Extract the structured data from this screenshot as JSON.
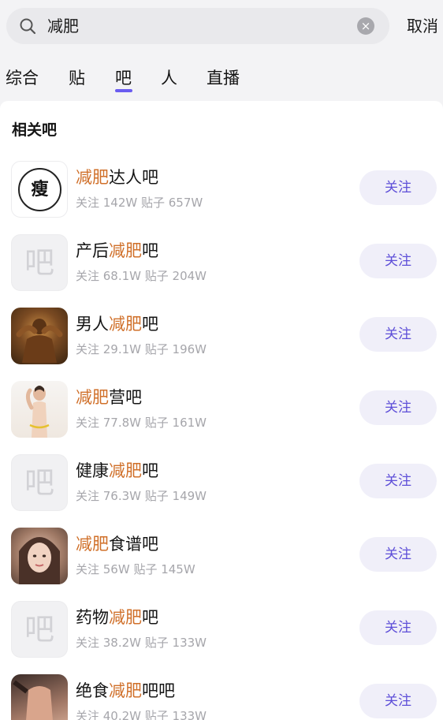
{
  "search": {
    "query": "减肥",
    "cancel_label": "取消"
  },
  "tabs": [
    {
      "label": "综合"
    },
    {
      "label": "贴"
    },
    {
      "label": "吧",
      "active": true
    },
    {
      "label": "人"
    },
    {
      "label": "直播"
    }
  ],
  "section_title": "相关吧",
  "follow_label": "关注",
  "colors": {
    "highlight": "#d0702a",
    "accent": "#6a5cf0",
    "follow_bg": "#f0eff9",
    "follow_text": "#5e4fd8"
  },
  "results": [
    {
      "name_pre": "",
      "name_hl": "减肥",
      "name_post": "达人吧",
      "meta": "关注 142W 贴子 657W",
      "avatar_icon": "瘦-character-icon",
      "avatar_text": "瘦"
    },
    {
      "name_pre": "产后",
      "name_hl": "减肥",
      "name_post": "吧",
      "meta": "关注 68.1W 贴子 204W",
      "avatar_icon": "default-bar-icon",
      "avatar_text": "吧"
    },
    {
      "name_pre": "男人",
      "name_hl": "减肥",
      "name_post": "吧",
      "meta": "关注 29.1W 贴子 196W",
      "avatar_icon": "muscular-man-photo",
      "avatar_text": ""
    },
    {
      "name_pre": "",
      "name_hl": "减肥",
      "name_post": "营吧",
      "meta": "关注 77.8W 贴子 161W",
      "avatar_icon": "woman-measuring-waist-photo",
      "avatar_text": ""
    },
    {
      "name_pre": "健康",
      "name_hl": "减肥",
      "name_post": "吧",
      "meta": "关注 76.3W 贴子 149W",
      "avatar_icon": "default-bar-icon",
      "avatar_text": "吧"
    },
    {
      "name_pre": "",
      "name_hl": "减肥",
      "name_post": "食谱吧",
      "meta": "关注 56W 贴子 145W",
      "avatar_icon": "girl-portrait-photo",
      "avatar_text": ""
    },
    {
      "name_pre": "药物",
      "name_hl": "减肥",
      "name_post": "吧",
      "meta": "关注 38.2W 贴子 133W",
      "avatar_icon": "default-bar-icon",
      "avatar_text": "吧"
    },
    {
      "name_pre": "绝食",
      "name_hl": "减肥",
      "name_post": "吧吧",
      "meta": "关注 40.2W 贴子 133W",
      "avatar_icon": "body-photo",
      "avatar_text": ""
    }
  ]
}
